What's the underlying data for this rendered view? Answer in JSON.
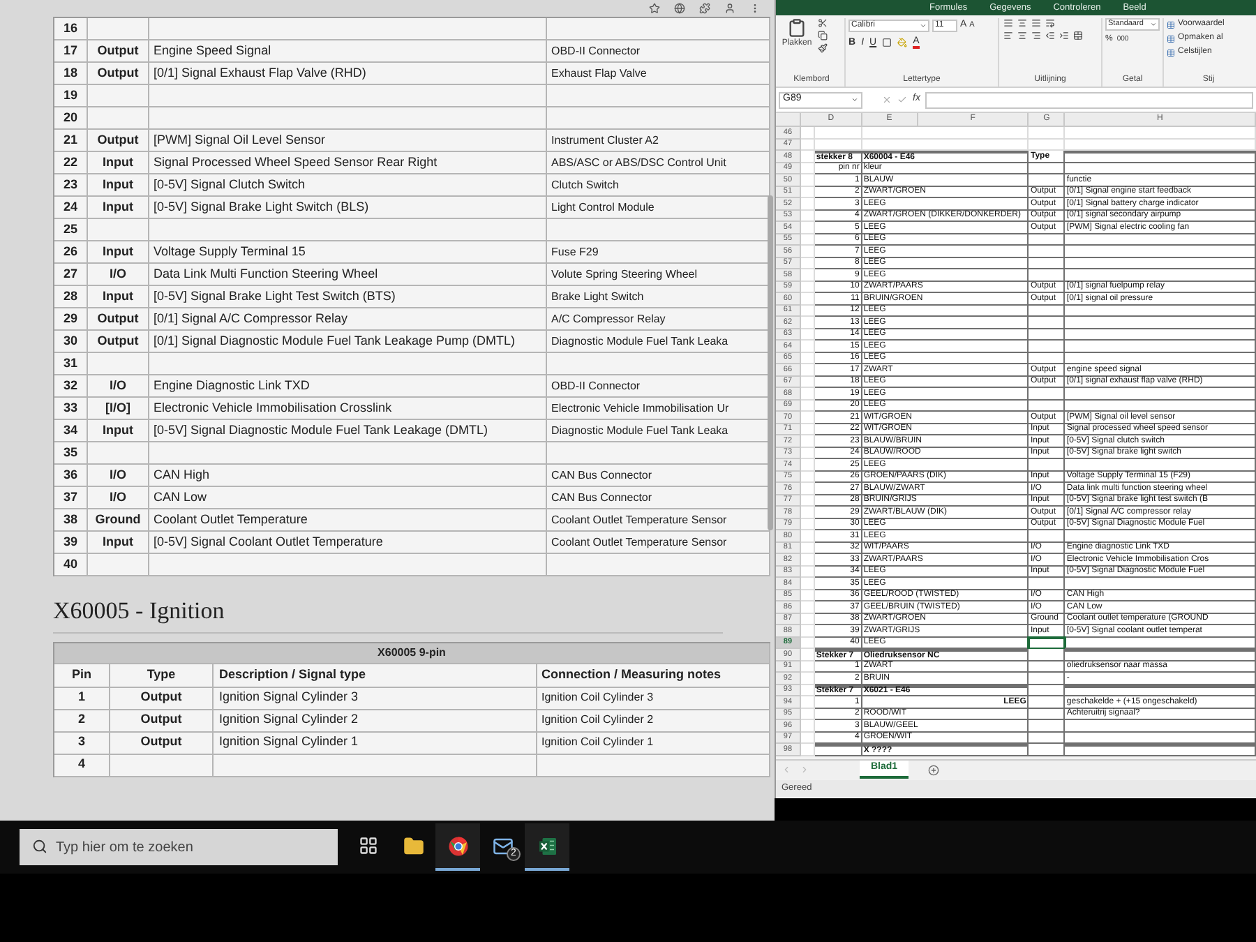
{
  "pin_table": {
    "rows": [
      {
        "pin": "16"
      },
      {
        "pin": "17",
        "type": "Output",
        "description": "Engine Speed Signal",
        "connection": "OBD-II Connector"
      },
      {
        "pin": "18",
        "type": "Output",
        "description": "[0/1] Signal Exhaust Flap Valve (RHD)",
        "connection": "Exhaust Flap Valve"
      },
      {
        "pin": "19"
      },
      {
        "pin": "20"
      },
      {
        "pin": "21",
        "type": "Output",
        "description": "[PWM] Signal Oil Level Sensor",
        "connection": "Instrument Cluster A2"
      },
      {
        "pin": "22",
        "type": "Input",
        "description": "Signal Processed Wheel Speed Sensor Rear Right",
        "connection": "ABS/ASC or ABS/DSC Control Unit"
      },
      {
        "pin": "23",
        "type": "Input",
        "description": "[0-5V] Signal Clutch Switch",
        "connection": "Clutch Switch"
      },
      {
        "pin": "24",
        "type": "Input",
        "description": "[0-5V] Signal Brake Light Switch (BLS)",
        "connection": "Light Control Module"
      },
      {
        "pin": "25"
      },
      {
        "pin": "26",
        "type": "Input",
        "description": "Voltage Supply Terminal 15",
        "connection": "Fuse F29"
      },
      {
        "pin": "27",
        "type": "I/O",
        "description": "Data Link Multi Function Steering Wheel",
        "connection": "Volute Spring Steering Wheel"
      },
      {
        "pin": "28",
        "type": "Input",
        "description": "[0-5V] Signal Brake Light Test Switch (BTS)",
        "connection": "Brake Light Switch"
      },
      {
        "pin": "29",
        "type": "Output",
        "description": "[0/1] Signal A/C Compressor Relay",
        "connection": "A/C Compressor Relay"
      },
      {
        "pin": "30",
        "type": "Output",
        "description": "[0/1] Signal Diagnostic Module Fuel Tank Leakage Pump (DMTL)",
        "connection": "Diagnostic Module Fuel Tank Leaka"
      },
      {
        "pin": "31"
      },
      {
        "pin": "32",
        "type": "I/O",
        "description": "Engine Diagnostic Link TXD",
        "connection": "OBD-II Connector"
      },
      {
        "pin": "33",
        "type": "[I/O]",
        "description": "Electronic Vehicle Immobilisation Crosslink",
        "connection": "Electronic Vehicle Immobilisation Ur"
      },
      {
        "pin": "34",
        "type": "Input",
        "description": "[0-5V] Signal Diagnostic Module Fuel Tank Leakage (DMTL)",
        "connection": "Diagnostic Module Fuel Tank Leaka"
      },
      {
        "pin": "35"
      },
      {
        "pin": "36",
        "type": "I/O",
        "description": "CAN High",
        "connection": "CAN Bus Connector"
      },
      {
        "pin": "37",
        "type": "I/O",
        "description": "CAN Low",
        "connection": "CAN Bus Connector"
      },
      {
        "pin": "38",
        "type": "Ground",
        "description": "Coolant Outlet Temperature",
        "connection": "Coolant Outlet Temperature Sensor"
      },
      {
        "pin": "39",
        "type": "Input",
        "description": "[0-5V] Signal Coolant Outlet Temperature",
        "connection": "Coolant Outlet Temperature Sensor"
      },
      {
        "pin": "40"
      }
    ]
  },
  "ignition": {
    "heading": "X60005 - Ignition",
    "table": {
      "title": "X60005 9-pin",
      "columns": [
        "Pin",
        "Type",
        "Description / Signal type",
        "Connection / Measuring notes"
      ],
      "rows": [
        {
          "pin": "1",
          "type": "Output",
          "description": "Ignition Signal Cylinder 3",
          "connection": "Ignition Coil Cylinder 3"
        },
        {
          "pin": "2",
          "type": "Output",
          "description": "Ignition Signal Cylinder 2",
          "connection": "Ignition Coil Cylinder 2"
        },
        {
          "pin": "3",
          "type": "Output",
          "description": "Ignition Signal Cylinder 1",
          "connection": "Ignition Coil Cylinder 1"
        },
        {
          "pin": "4"
        }
      ]
    }
  },
  "excel": {
    "ribbon_tabs": [
      "Formules",
      "Gegevens",
      "Controleren",
      "Beeld"
    ],
    "clipboard": {
      "paste": "Plakken",
      "group": "Klembord"
    },
    "font": {
      "name": "Calibri",
      "size": "11",
      "grow": "A",
      "shrink": "A",
      "styles": [
        "B",
        "I",
        "U"
      ],
      "color_label": "A",
      "group": "Lettertype"
    },
    "alignment": {
      "group": "Uitlijning"
    },
    "number": {
      "format": "Standaard",
      "percent": "%",
      "thousands": "000",
      "group": "Getal"
    },
    "styles": {
      "items": [
        "Voorwaardel",
        "Opmaken al",
        "Celstijlen"
      ],
      "group": "Stij"
    },
    "name_box": "G89",
    "formula_label": "fx",
    "columns": [
      "D",
      "E",
      "F",
      "G",
      "H"
    ],
    "rows": [
      {
        "n": "46",
        "kind": "empty",
        "selected": false
      },
      {
        "n": "47",
        "kind": "empty",
        "selected": false
      },
      {
        "n": "48",
        "kind": "header",
        "a": "stekker 8",
        "b": "X60004 - E46",
        "type": "Type",
        "selected": false
      },
      {
        "n": "49",
        "kind": "data",
        "pin": "pin nr",
        "kleur": "kleur",
        "selected": false
      },
      {
        "n": "50",
        "kind": "data",
        "pin": "1",
        "kleur": "BLAUW",
        "functie": "functie",
        "selected": false
      },
      {
        "n": "51",
        "kind": "data",
        "pin": "2",
        "kleur": "ZWART/GROEN",
        "type": "Output",
        "functie": "[0/1] Signal engine start feedback",
        "selected": false
      },
      {
        "n": "52",
        "kind": "data",
        "pin": "3",
        "kleur": "LEEG",
        "type": "Output",
        "functie": "[0/1] Signal battery charge indicator",
        "selected": false
      },
      {
        "n": "53",
        "kind": "data",
        "pin": "4",
        "kleur": "ZWART/GROEN (DIKKER/DONKERDER)",
        "type": "Output",
        "functie": "[0/1] signal secondary airpump",
        "selected": false
      },
      {
        "n": "54",
        "kind": "data",
        "pin": "5",
        "kleur": "LEEG",
        "type": "Output",
        "functie": "[PWM] Signal electric cooling fan",
        "selected": false
      },
      {
        "n": "55",
        "kind": "data",
        "pin": "6",
        "kleur": "LEEG",
        "selected": false
      },
      {
        "n": "56",
        "kind": "data",
        "pin": "7",
        "kleur": "LEEG",
        "selected": false
      },
      {
        "n": "57",
        "kind": "data",
        "pin": "8",
        "kleur": "LEEG",
        "selected": false
      },
      {
        "n": "58",
        "kind": "data",
        "pin": "9",
        "kleur": "LEEG",
        "selected": false
      },
      {
        "n": "59",
        "kind": "data",
        "pin": "10",
        "kleur": "ZWART/PAARS",
        "type": "Output",
        "functie": "[0/1] signal fuelpump relay",
        "selected": false
      },
      {
        "n": "60",
        "kind": "data",
        "pin": "11",
        "kleur": "BRUIN/GROEN",
        "type": "Output",
        "functie": "[0/1] signal oil pressure",
        "selected": false
      },
      {
        "n": "61",
        "kind": "data",
        "pin": "12",
        "kleur": "LEEG",
        "selected": false
      },
      {
        "n": "62",
        "kind": "data",
        "pin": "13",
        "kleur": "LEEG",
        "selected": false
      },
      {
        "n": "63",
        "kind": "data",
        "pin": "14",
        "kleur": "LEEG",
        "selected": false
      },
      {
        "n": "64",
        "kind": "data",
        "pin": "15",
        "kleur": "LEEG",
        "selected": false
      },
      {
        "n": "65",
        "kind": "data",
        "pin": "16",
        "kleur": "LEEG",
        "selected": false
      },
      {
        "n": "66",
        "kind": "data",
        "pin": "17",
        "kleur": "ZWART",
        "type": "Output",
        "functie": "engine speed signal",
        "selected": false
      },
      {
        "n": "67",
        "kind": "data",
        "pin": "18",
        "kleur": "LEEG",
        "type": "Output",
        "functie": "[0/1] signal exhaust flap valve (RHD)",
        "selected": false
      },
      {
        "n": "68",
        "kind": "data",
        "pin": "19",
        "kleur": "LEEG",
        "selected": false
      },
      {
        "n": "69",
        "kind": "data",
        "pin": "20",
        "kleur": "LEEG",
        "selected": false
      },
      {
        "n": "70",
        "kind": "data",
        "pin": "21",
        "kleur": "WIT/GROEN",
        "type": "Output",
        "functie": "[PWM] Signal oil level sensor",
        "selected": false
      },
      {
        "n": "71",
        "kind": "data",
        "pin": "22",
        "kleur": "WIT/GROEN",
        "type": "Input",
        "functie": "Signal processed wheel speed sensor",
        "selected": false
      },
      {
        "n": "72",
        "kind": "data",
        "pin": "23",
        "kleur": "BLAUW/BRUIN",
        "type": "Input",
        "functie": "[0-5V] Signal clutch switch",
        "selected": false
      },
      {
        "n": "73",
        "kind": "data",
        "pin": "24",
        "kleur": "BLAUW/ROOD",
        "type": "Input",
        "functie": "[0-5V] Signal brake light switch",
        "selected": false
      },
      {
        "n": "74",
        "kind": "data",
        "pin": "25",
        "kleur": "LEEG",
        "selected": false
      },
      {
        "n": "75",
        "kind": "data",
        "pin": "26",
        "kleur": "GROEN/PAARS (DIK)",
        "type": "Input",
        "functie": "Voltage Supply Terminal 15 (F29)",
        "selected": false
      },
      {
        "n": "76",
        "kind": "data",
        "pin": "27",
        "kleur": "BLAUW/ZWART",
        "type": "I/O",
        "functie": "Data link multi function steering wheel",
        "selected": false
      },
      {
        "n": "77",
        "kind": "data",
        "pin": "28",
        "kleur": "BRUIN/GRIJS",
        "type": "Input",
        "functie": "[0-5V] Signal brake light test switch (B",
        "selected": false
      },
      {
        "n": "78",
        "kind": "data",
        "pin": "29",
        "kleur": "ZWART/BLAUW (DIK)",
        "type": "Output",
        "functie": "[0/1] Signal A/C compressor relay",
        "selected": false
      },
      {
        "n": "79",
        "kind": "data",
        "pin": "30",
        "kleur": "LEEG",
        "type": "Output",
        "functie": "[0-5V] Signal Diagnostic Module Fuel",
        "selected": false
      },
      {
        "n": "80",
        "kind": "data",
        "pin": "31",
        "kleur": "LEEG",
        "selected": false
      },
      {
        "n": "81",
        "kind": "data",
        "pin": "32",
        "kleur": "WIT/PAARS",
        "type": "I/O",
        "functie": "Engine diagnostic Link TXD",
        "selected": false
      },
      {
        "n": "82",
        "kind": "data",
        "pin": "33",
        "kleur": "ZWART/PAARS",
        "type": "I/O",
        "functie": "Electronic Vehicle Immobilisation Cros",
        "selected": false
      },
      {
        "n": "83",
        "kind": "data",
        "pin": "34",
        "kleur": "LEEG",
        "type": "Input",
        "functie": "[0-5V] Signal Diagnostic Module Fuel",
        "selected": false
      },
      {
        "n": "84",
        "kind": "data",
        "pin": "35",
        "kleur": "LEEG",
        "selected": false
      },
      {
        "n": "85",
        "kind": "data",
        "pin": "36",
        "kleur": "GEEL/ROOD (TWISTED)",
        "type": "I/O",
        "functie": "CAN High",
        "selected": false
      },
      {
        "n": "86",
        "kind": "data",
        "pin": "37",
        "kleur": "GEEL/BRUIN (TWISTED)",
        "type": "I/O",
        "functie": "CAN Low",
        "selected": false
      },
      {
        "n": "87",
        "kind": "data",
        "pin": "38",
        "kleur": "ZWART/GROEN",
        "type": "Ground",
        "functie": "Coolant outlet temperature (GROUND",
        "selected": false
      },
      {
        "n": "88",
        "kind": "data",
        "pin": "39",
        "kleur": "ZWART/GRIJS",
        "type": "Input",
        "functie": "[0-5V] Signal coolant outlet temperat",
        "selected": false
      },
      {
        "n": "89",
        "kind": "data",
        "pin": "40",
        "kleur": "LEEG",
        "selected": true
      },
      {
        "n": "90",
        "kind": "header",
        "a": "Stekker 7",
        "b": "Oliedruksensor NC",
        "selected": false
      },
      {
        "n": "91",
        "kind": "data",
        "pin": "1",
        "kleur": "ZWART",
        "functie": "oliedruksensor naar massa",
        "selected": false
      },
      {
        "n": "92",
        "kind": "data",
        "pin": "2",
        "kleur": "BRUIN",
        "functie": "-",
        "selected": false
      },
      {
        "n": "93",
        "kind": "header",
        "a": "Stekker 7",
        "b": "X6021 - E46",
        "selected": false
      },
      {
        "n": "94",
        "kind": "note",
        "pin": "1",
        "kleur": "LEEG",
        "functie": "geschakelde + (+15 ongeschakeld)",
        "selected": false
      },
      {
        "n": "95",
        "kind": "data",
        "pin": "2",
        "kleur": "ROOD/WIT",
        "functie": "Achteruitrij signaal?",
        "selected": false
      },
      {
        "n": "96",
        "kind": "data",
        "pin": "3",
        "kleur": "BLAUW/GEEL",
        "selected": false
      },
      {
        "n": "97",
        "kind": "data",
        "pin": "4",
        "kleur": "GROEN/WIT",
        "selected": false
      },
      {
        "n": "98",
        "kind": "header",
        "b": "X ????",
        "selected": false
      }
    ],
    "sheet_tabs": [
      {
        "label": "Blad1",
        "selected": true
      }
    ],
    "status": "Gereed"
  },
  "taskbar": {
    "search_placeholder": "Typ hier om te zoeken",
    "apps": [
      {
        "kind": "task-view",
        "running": false
      },
      {
        "kind": "folder",
        "running": false
      },
      {
        "kind": "browser",
        "running": true
      },
      {
        "kind": "mail",
        "running": false,
        "badge": "2"
      },
      {
        "kind": "spreadsheet",
        "running": true
      }
    ]
  }
}
